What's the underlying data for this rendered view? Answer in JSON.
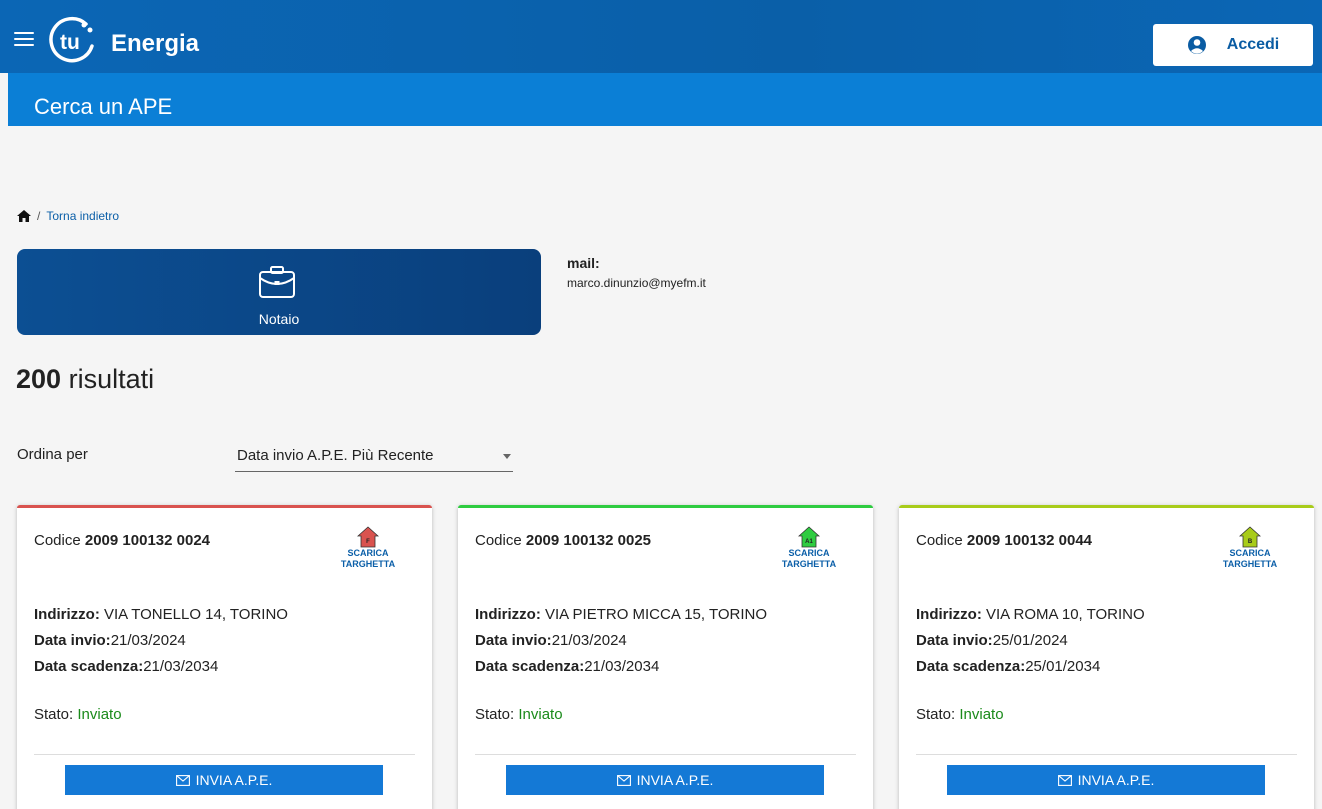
{
  "header": {
    "brand": "Energia",
    "login_label": "Accedi"
  },
  "subheader": {
    "title": "Cerca un APE"
  },
  "breadcrumb": {
    "back_label": "Torna indietro"
  },
  "role": {
    "label": "Notaio"
  },
  "contact": {
    "mail_label": "mail:",
    "mail_value": "marco.dinunzio@myefm.it"
  },
  "results": {
    "count": "200",
    "label": "risultati"
  },
  "sort": {
    "label": "Ordina per",
    "selected": "Data invio A.P.E. Più Recente"
  },
  "cards": [
    {
      "code_prefix": "Codice",
      "code": "2009 100132 0024",
      "energy_class": "F",
      "class_color": "#d9534f",
      "download_line1": "SCARICA",
      "download_line2": "TARGHETTA",
      "address_label": "Indirizzo:",
      "address": "VIA TONELLO 14, TORINO",
      "sent_label": "Data invio:",
      "sent": "21/03/2024",
      "expiry_label": "Data scadenza:",
      "expiry": "21/03/2034",
      "status_label": "Stato:",
      "status": "Inviato",
      "send_label": "INVIA A.P.E."
    },
    {
      "code_prefix": "Codice",
      "code": "2009 100132 0025",
      "energy_class": "A1",
      "class_color": "#2ecc40",
      "download_line1": "SCARICA",
      "download_line2": "TARGHETTA",
      "address_label": "Indirizzo:",
      "address": "VIA PIETRO MICCA 15, TORINO",
      "sent_label": "Data invio:",
      "sent": "21/03/2024",
      "expiry_label": "Data scadenza:",
      "expiry": "21/03/2034",
      "status_label": "Stato:",
      "status": "Inviato",
      "send_label": "INVIA A.P.E."
    },
    {
      "code_prefix": "Codice",
      "code": "2009 100132 0044",
      "energy_class": "B",
      "class_color": "#a8cc1a",
      "download_line1": "SCARICA",
      "download_line2": "TARGHETTA",
      "address_label": "Indirizzo:",
      "address": "VIA ROMA 10, TORINO",
      "sent_label": "Data invio:",
      "sent": "25/01/2024",
      "expiry_label": "Data scadenza:",
      "expiry": "25/01/2034",
      "status_label": "Stato:",
      "status": "Inviato",
      "send_label": "INVIA A.P.E."
    }
  ]
}
